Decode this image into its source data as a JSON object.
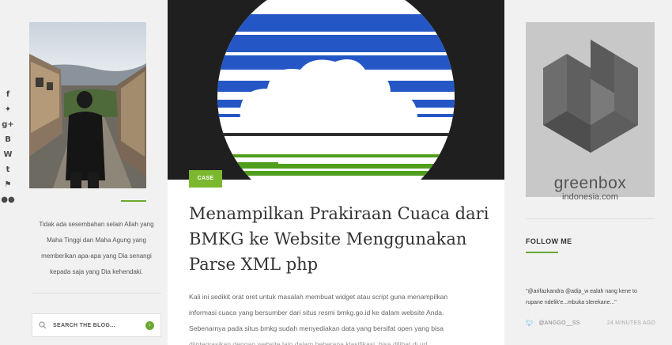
{
  "social": {
    "items": [
      {
        "name": "facebook-icon",
        "glyph": "f"
      },
      {
        "name": "twitter-icon",
        "glyph": "✦"
      },
      {
        "name": "google-plus-icon",
        "glyph": "g+"
      },
      {
        "name": "blogger-icon",
        "glyph": "B"
      },
      {
        "name": "wordpress-icon",
        "glyph": "W"
      },
      {
        "name": "tumblr-icon",
        "glyph": "t"
      },
      {
        "name": "foursquare-icon",
        "glyph": "⚑"
      },
      {
        "name": "flickr-icon",
        "glyph": "●●"
      }
    ]
  },
  "left": {
    "bio_lines": [
      "Tidak ada sesembahan selain Allah yang",
      "Maha Tinggi dan Maha Agung yang",
      "memberikan apa-apa yang Dia senangi",
      "kepada saja yang Dia kehendaki."
    ],
    "search_placeholder": "SEARCH THE BLOG...",
    "accent_color": "#6aa733"
  },
  "post": {
    "category": "CASE",
    "title_lines": [
      "Menampilkan Prakiraan Cuaca dari",
      "BMKG ke Website Menggunakan",
      "Parse XML php"
    ],
    "excerpt_lines": [
      "Kali ini sedikit orat oret untuk masalah membuat widget atau script guna menampilkan",
      "informasi cuaca yang bersumber dari situs resmi bmkg.go.id ke dalam website Anda.",
      "Sebenarnya pada situs bmkg sudah menyediakan data yang bersifat open yang bisa",
      "diintegrasikan dengan website lain dalam beberapa klasifikasi, bisa dilihat di url"
    ]
  },
  "right": {
    "logo_line1": "greenbox",
    "logo_line2": "indonesia.com",
    "follow_title": "FOLLOW ME",
    "tweet_text": "\"@arifazkandra @adip_w ealah nang kene to rupane ndelik'e...mbuka slerekane...\"",
    "tweet_handle": "@ANGGO__SS",
    "tweet_time": "24 MINUTES AGO"
  }
}
